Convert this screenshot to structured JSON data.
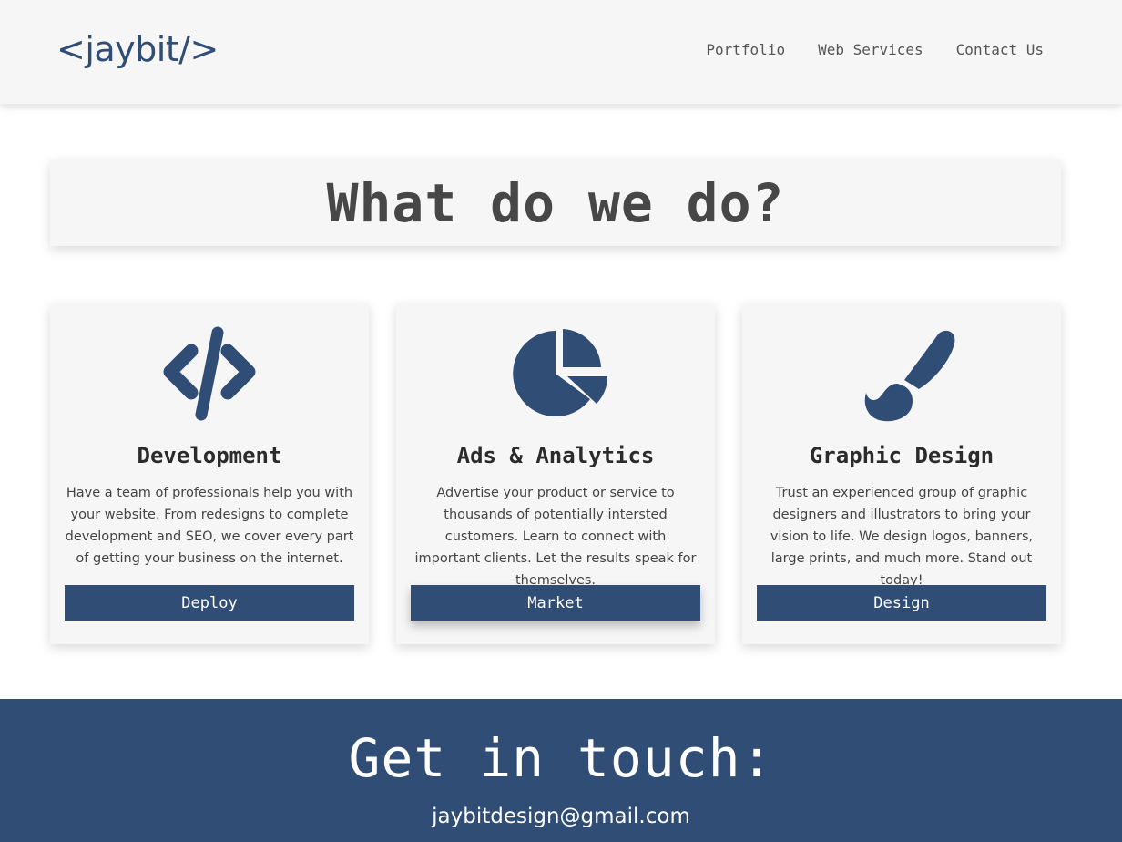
{
  "header": {
    "logo": "<jaybit/>",
    "nav": [
      "Portfolio",
      "Web Services",
      "Contact Us"
    ]
  },
  "banner": {
    "title": "What do we do?"
  },
  "services": [
    {
      "icon": "code-icon",
      "title": "Development",
      "description": "Have a team of professionals help you with your website.  From redesigns to complete development and SEO, we cover every part of getting your business on the internet.",
      "button": "Deploy"
    },
    {
      "icon": "pie-chart-icon",
      "title": "Ads & Analytics",
      "description": "Advertise your product or service to thousands of potentially intersted customers. Learn to connect with important clients. Let the results speak for themselves.",
      "button": "Market"
    },
    {
      "icon": "paintbrush-icon",
      "title": "Graphic Design",
      "description": "Trust an experienced group of graphic designers and illustrators to bring your vision to life. We design logos, banners, large prints, and much more. Stand out today!",
      "button": "Design"
    }
  ],
  "footer": {
    "title": "Get in touch:",
    "email": "jaybitdesign@gmail.com"
  },
  "colors": {
    "accent": "#304d75",
    "panel": "#f6f6f6",
    "text": "#444444"
  }
}
